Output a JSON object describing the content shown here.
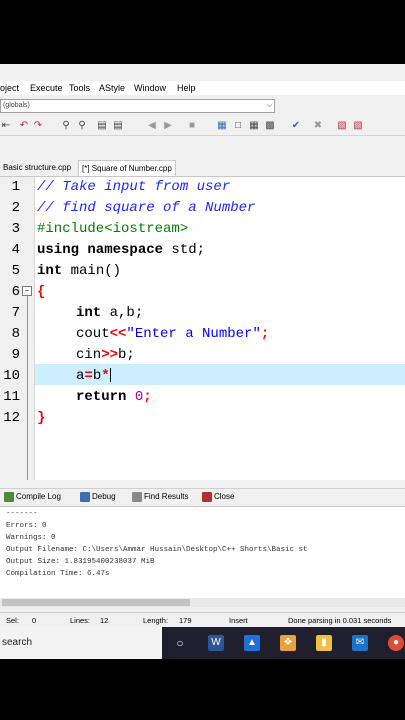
{
  "menubar": {
    "items": [
      "oject",
      "Execute",
      "Tools",
      "AStyle",
      "Window",
      "Help"
    ]
  },
  "scope": {
    "value": "(globals)"
  },
  "tabs": [
    {
      "label": "Basic structure.cpp",
      "active": false
    },
    {
      "label": "[*] Square of Number.cpp",
      "active": true
    }
  ],
  "editor": {
    "line_numbers": [
      "1",
      "2",
      "3",
      "4",
      "5",
      "6",
      "7",
      "8",
      "9",
      "10",
      "11",
      "12"
    ],
    "lines": {
      "l1": "// Take input from user",
      "l2": "// find square of a Number",
      "l3": "#include<iostream>",
      "l4_kw": "using namespace",
      "l4_rest": " std;",
      "l5_kw": "int",
      "l5_rest": " main()",
      "l6": "{",
      "l7_kw": "int",
      "l7_rest": " a,b;",
      "l8_a": "cout",
      "l8_b": "<<",
      "l8_str": "\"Enter a Number\"",
      "l8_c": ";",
      "l9_a": "cin",
      "l9_b": ">>",
      "l9_c": "b;",
      "l10_a": "a",
      "l10_b": "=",
      "l10_c": "b",
      "l10_d": "*",
      "l11_kw": "return",
      "l11_num": "0",
      "l11_c": ";",
      "l12": "}"
    },
    "fold_symbol": "−"
  },
  "panel": {
    "tabs": [
      "Compile Log",
      "Debug",
      "Find Results",
      "Close"
    ],
    "log": [
      "-------",
      "Errors: 0",
      "Warnings: 0",
      "Output Filename: C:\\Users\\Ammar Hussain\\Desktop\\C++ Shorts\\Basic st",
      "Output Size: 1.83195400238037 MiB",
      "Compilation Time: 6.47s"
    ]
  },
  "status": {
    "sel_label": "Sel:",
    "sel_value": "0",
    "lines_label": "Lines:",
    "lines_value": "12",
    "length_label": "Length:",
    "length_value": "179",
    "mode": "Insert",
    "message": "Done parsing in 0.031 seconds"
  },
  "taskbar": {
    "search": "search"
  },
  "colors": {
    "current_line": "#cceeff",
    "comment": "#2525ff",
    "preprocessor": "#008000",
    "string": "#0000ff",
    "number": "#a000a0",
    "symbol": "#ff0000"
  }
}
